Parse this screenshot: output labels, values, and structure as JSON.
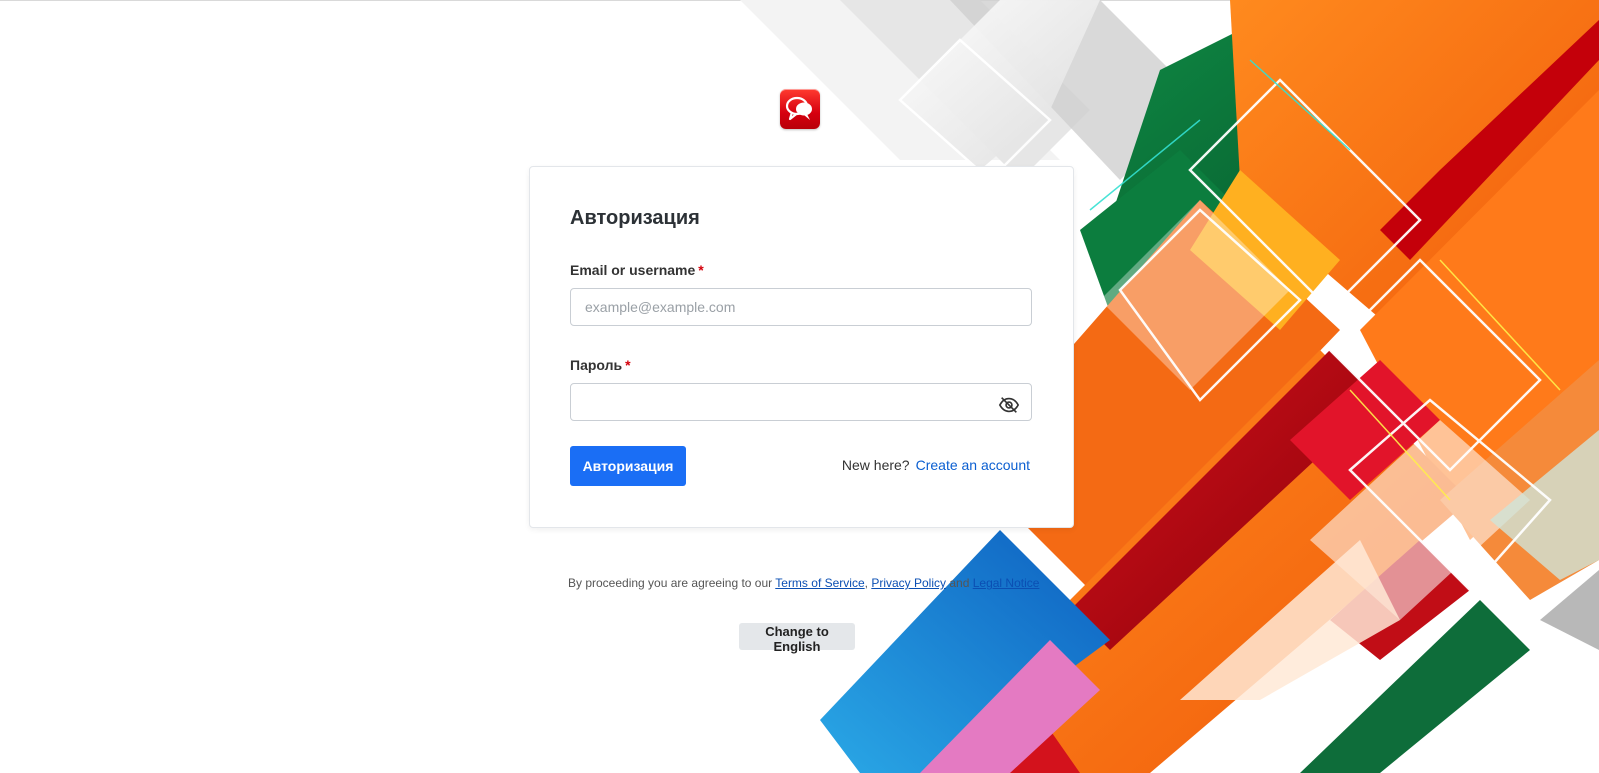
{
  "login": {
    "title": "Авторизация",
    "email_label": "Email or username",
    "email_placeholder": "example@example.com",
    "email_value": "",
    "password_label": "Пароль",
    "password_value": "",
    "required_marker": "*",
    "submit_label": "Авторизация",
    "new_here_text": "New here?",
    "create_account_label": "Create an account"
  },
  "legal": {
    "prefix": "By proceeding you are agreeing to our",
    "terms_label": "Terms of Service",
    "sep1": ",",
    "privacy_label": "Privacy Policy",
    "sep2": "and",
    "legal_label": "Legal Notice"
  },
  "language": {
    "change_label": "Change to English"
  },
  "icons": {
    "logo": "chat-bubbles-icon",
    "password_toggle": "eye-off-icon"
  },
  "colors": {
    "primary": "#1a6ef5",
    "link": "#0b5fd1",
    "required": "#d4000b",
    "logo_red": "#e0000d"
  }
}
